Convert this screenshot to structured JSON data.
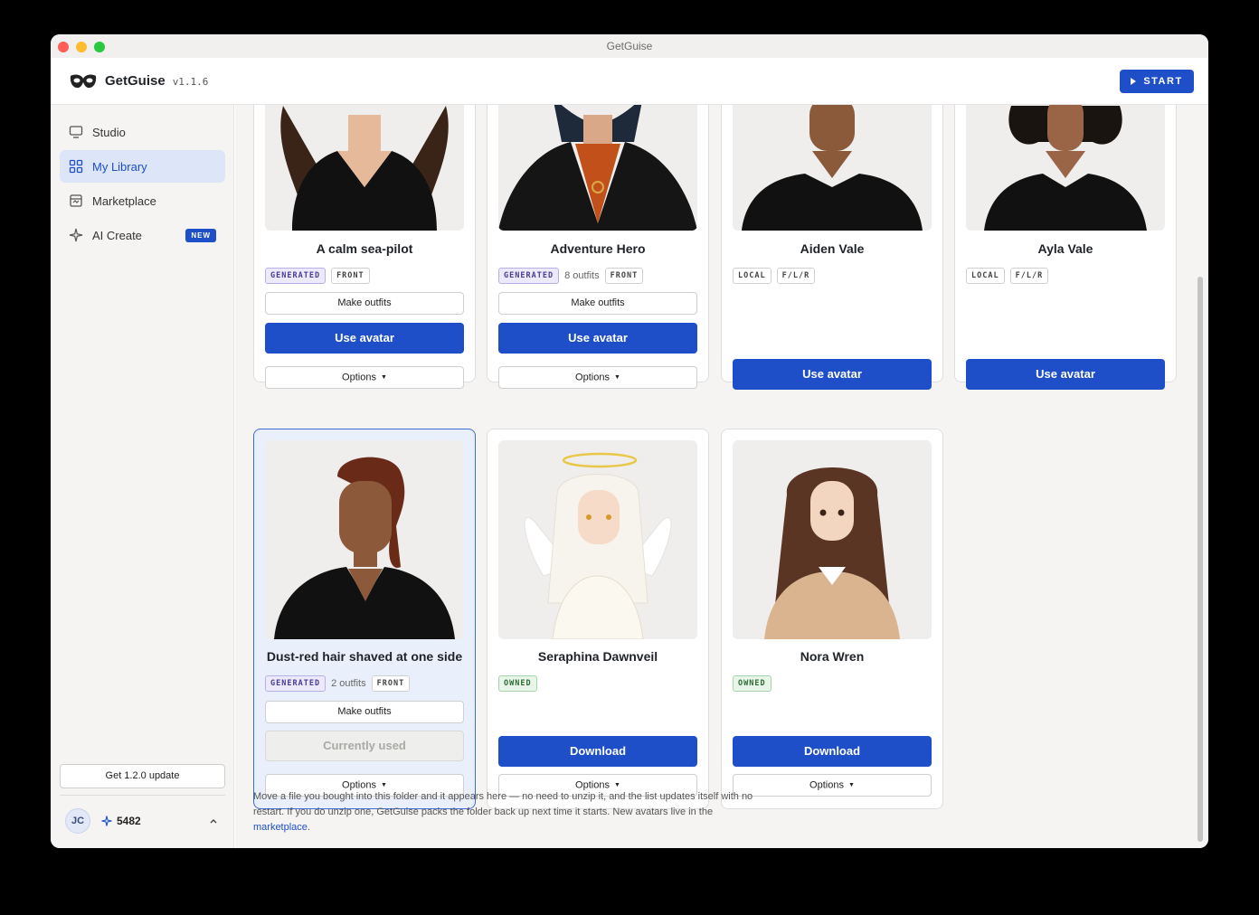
{
  "window": {
    "title": "GetGuise"
  },
  "header": {
    "app_name": "GetGuise",
    "version": "v1.1.6",
    "start_label": "START"
  },
  "sidebar": {
    "items": [
      {
        "label": "Studio",
        "icon": "monitor-icon"
      },
      {
        "label": "My Library",
        "icon": "grid-icon",
        "active": true
      },
      {
        "label": "Marketplace",
        "icon": "store-icon"
      },
      {
        "label": "AI Create",
        "icon": "sparkle-icon",
        "badge": "NEW"
      }
    ],
    "update_label": "Get 1.2.0 update",
    "user": {
      "initials": "JC",
      "credits": "5482"
    }
  },
  "cards": [
    {
      "name": "A calm sea-pilot",
      "badges": [
        "GENERATED",
        "FRONT"
      ],
      "make_outfits": "Make outfits",
      "primary": "Use avatar",
      "options": "Options"
    },
    {
      "name": "Adventure Hero",
      "badges": [
        "GENERATED",
        "FRONT"
      ],
      "outfits": "8 outfits",
      "make_outfits": "Make outfits",
      "primary": "Use avatar",
      "options": "Options"
    },
    {
      "name": "Aiden Vale",
      "badges": [
        "LOCAL",
        "F/L/R"
      ],
      "primary": "Use avatar"
    },
    {
      "name": "Ayla Vale",
      "badges": [
        "LOCAL",
        "F/L/R"
      ],
      "primary": "Use avatar"
    },
    {
      "name": "Dust-red hair shaved at one side",
      "badges": [
        "GENERATED",
        "FRONT"
      ],
      "outfits": "2 outfits",
      "make_outfits": "Make outfits",
      "primary": "Currently used",
      "options": "Options",
      "selected": true
    },
    {
      "name": "Seraphina Dawnveil",
      "badges": [
        "OWNED"
      ],
      "primary": "Download",
      "options": "Options"
    },
    {
      "name": "Nora Wren",
      "badges": [
        "OWNED"
      ],
      "primary": "Download",
      "options": "Options"
    }
  ],
  "footnote": {
    "text": "Move a file you bought into this folder and it appears here — no need to unzip it, and the list updates itself with no restart. If you do unzip one, GetGuise packs the folder back up next time it starts. New avatars live in the ",
    "link": "marketplace",
    "end": "."
  },
  "colors": {
    "accent": "#1e4fc9",
    "generated_badge": "#ece9fb",
    "owned_badge": "#e8f5e9"
  }
}
